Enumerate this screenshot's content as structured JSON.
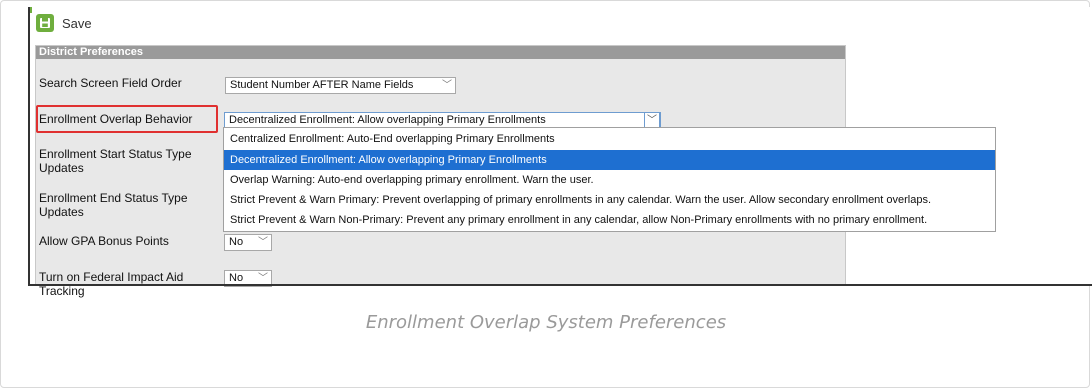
{
  "toolbar": {
    "save_label": "Save"
  },
  "panel": {
    "title": "District Preferences",
    "rows": [
      {
        "label": "Search Screen Field Order",
        "value": "Student Number AFTER Name Fields"
      },
      {
        "label": "Enrollment Overlap Behavior",
        "value": "Decentralized Enrollment: Allow overlapping Primary Enrollments"
      },
      {
        "label": "Enrollment Start Status Type Updates"
      },
      {
        "label": "Enrollment End Status Type Updates"
      },
      {
        "label": "Allow GPA Bonus Points",
        "value": "No"
      },
      {
        "label": "Turn on Federal Impact Aid Tracking",
        "value": "No"
      }
    ]
  },
  "dropdown": {
    "options": [
      "Centralized Enrollment: Auto-End overlapping Primary Enrollments",
      "Decentralized Enrollment: Allow overlapping Primary Enrollments",
      "Overlap Warning: Auto-end overlapping primary enrollment. Warn the user.",
      "Strict Prevent & Warn Primary: Prevent overlapping of primary enrollments in any calendar. Warn the user. Allow secondary enrollment overlaps.",
      "Strict Prevent & Warn Non-Primary: Prevent any primary enrollment in any calendar, allow Non-Primary enrollments with no primary enrollment."
    ],
    "selected_index": 1
  },
  "caption": "Enrollment Overlap System Preferences",
  "colors": {
    "accent": "#6fae3e",
    "highlight": "#e03030",
    "selection": "#1e6fd1"
  },
  "icons": {
    "save": "save-icon",
    "chevron": "chevron-down-icon"
  }
}
